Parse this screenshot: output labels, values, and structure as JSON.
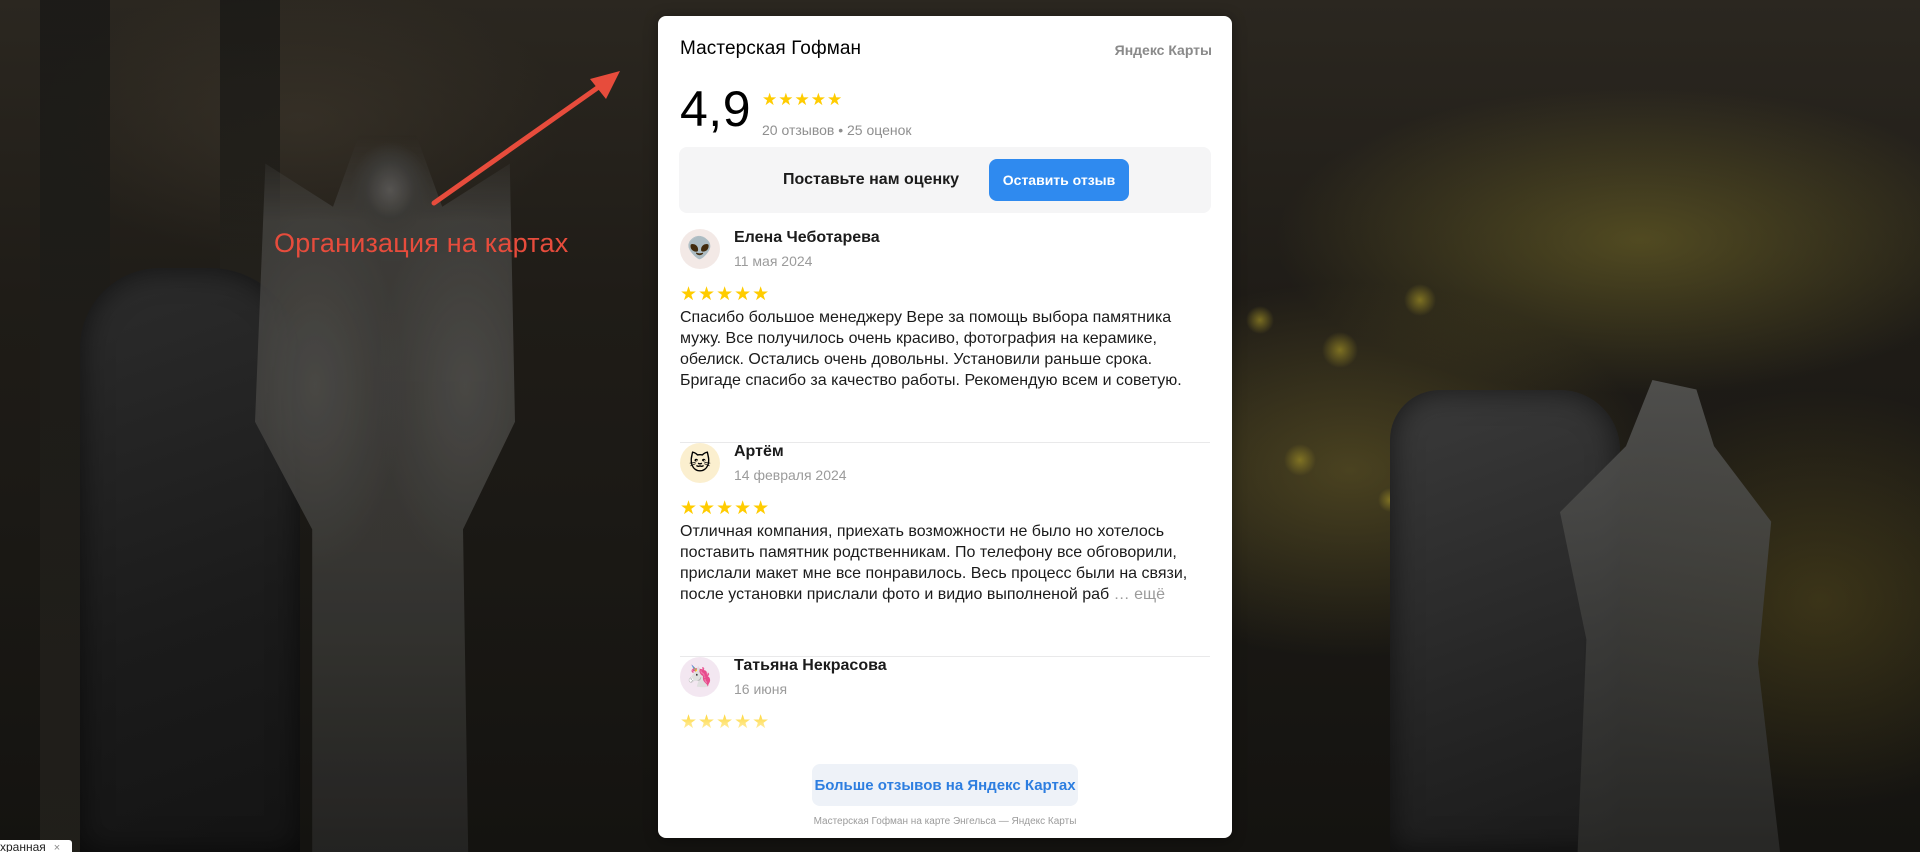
{
  "widget": {
    "org_name": "Мастерская Гофман",
    "source_link": "Яндекс Карты",
    "rating": {
      "value": "4,9",
      "stars": "★★★★★",
      "count_text": "20 отзывов • 25 оценок"
    },
    "cta": {
      "prompt": "Поставьте нам оценку",
      "button_label": "Оставить отзыв"
    },
    "reviews": [
      {
        "author": "Елена Чеботарева",
        "date": "11 мая 2024",
        "avatar_emoji": "👽",
        "stars": "★★★★★",
        "text": "Спасибо большое менеджеру Вере за помощь выбора памятника мужу. Все получилось очень красиво, фотография на керамике, обелиск. Остались очень довольны. Установили раньше срока. Бригаде спасибо за качество работы. Рекомендую всем и советую."
      },
      {
        "author": "Артём",
        "date": "14 февраля 2024",
        "avatar_emoji": "🐱",
        "stars": "★★★★★",
        "text": "Отличная компания, приехать возможности не было но хотелось поставить памятник родственникам. По телефону все обговорили, прислали макет мне все понравилось. Весь процесс были на связи, после установки прислали фото и видио выполненой раб",
        "more_label": "… ещё"
      },
      {
        "author": "Татьяна Некрасова",
        "date": "16 июня",
        "avatar_emoji": "🦄",
        "stars": "★★★★★"
      }
    ],
    "more_reviews_label": "Больше отзывов на Яндекс Картах",
    "footer_caption": "Мастерская Гофман на карте Энгельса — Яндекс Карты"
  },
  "annotation": {
    "label": "Организация на картах",
    "color": "#e74c3c"
  },
  "corner_tag": {
    "text": "хранная",
    "close_icon": "×"
  },
  "colors": {
    "star": "#ffcc00",
    "primary_button": "#2f8aef",
    "link_button_text": "#2d7ee0"
  }
}
